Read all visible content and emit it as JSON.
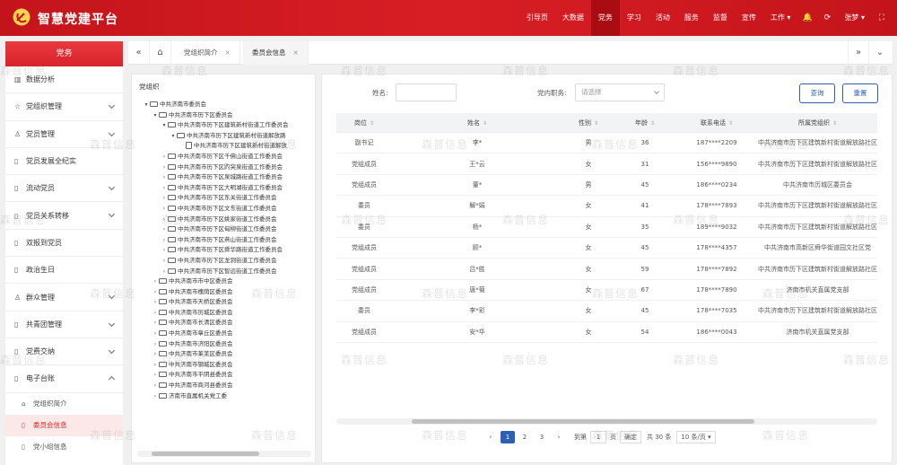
{
  "app": {
    "brand": "智慧党建平台"
  },
  "colors": {
    "primary_red": "#d9232a",
    "accent_blue": "#2f5fb3"
  },
  "nav": {
    "items": [
      {
        "label": "引导页",
        "active": false
      },
      {
        "label": "大数据",
        "active": false
      },
      {
        "label": "党务",
        "active": true
      },
      {
        "label": "学习",
        "active": false
      },
      {
        "label": "活动",
        "active": false
      },
      {
        "label": "服务",
        "active": false
      },
      {
        "label": "监督",
        "active": false
      },
      {
        "label": "宣传",
        "active": false
      },
      {
        "label": "工作",
        "active": false
      }
    ],
    "user": "张梦"
  },
  "sidebar": {
    "title": "党务",
    "items": [
      {
        "label": "数据分析",
        "icon": "chart-icon"
      },
      {
        "label": "党组织管理",
        "icon": "star-icon"
      },
      {
        "label": "党员管理",
        "icon": "user-icon"
      },
      {
        "label": "党员发展全纪实",
        "icon": "doc-icon"
      },
      {
        "label": "流动党员",
        "icon": "doc-icon"
      },
      {
        "label": "党员关系转移",
        "icon": "doc-icon"
      },
      {
        "label": "双报到党员",
        "icon": "doc-icon"
      },
      {
        "label": "政治生日",
        "icon": "doc-icon"
      },
      {
        "label": "群众管理",
        "icon": "user-icon"
      },
      {
        "label": "共青团管理",
        "icon": "doc-icon"
      },
      {
        "label": "党费交纳",
        "icon": "doc-icon"
      },
      {
        "label": "电子台账",
        "icon": "doc-icon"
      }
    ],
    "subitems": [
      {
        "label": "党组织简介",
        "active": false
      },
      {
        "label": "委员会信息",
        "active": true
      },
      {
        "label": "党小组信息",
        "active": false
      }
    ]
  },
  "tabs": [
    {
      "label": "党组织简介",
      "active": false
    },
    {
      "label": "委员会信息",
      "active": true
    }
  ],
  "tree": {
    "title": "党组织",
    "nodes": [
      {
        "label": "中共济南市委员会",
        "level": 0,
        "expanded": true,
        "leaf": false
      },
      {
        "label": "中共济南市历下区委员会",
        "level": 1,
        "expanded": true,
        "leaf": false
      },
      {
        "label": "中共济南市历下区建筑新村街道工作委员会",
        "level": 2,
        "expanded": true,
        "leaf": false
      },
      {
        "label": "中共济南市历下区建筑新村街道解放路",
        "level": 3,
        "expanded": true,
        "leaf": false
      },
      {
        "label": "中共济南市历下区建筑新村街道解放",
        "level": 4,
        "expanded": false,
        "leaf": true
      },
      {
        "label": "中共济南市历下区千佛山街道工作委员会",
        "level": 2,
        "expanded": false,
        "leaf": false
      },
      {
        "label": "中共济南市历下区趵突泉街道工作委员会",
        "level": 2,
        "expanded": false,
        "leaf": false
      },
      {
        "label": "中共济南市历下区泉城路街道工作委员会",
        "level": 2,
        "expanded": false,
        "leaf": false
      },
      {
        "label": "中共济南市历下区大明湖街道工作委员会",
        "level": 2,
        "expanded": false,
        "leaf": false
      },
      {
        "label": "中共济南市历下区东关街道工作委员会",
        "level": 2,
        "expanded": false,
        "leaf": false
      },
      {
        "label": "中共济南市历下区文东街道工作委员会",
        "level": 2,
        "expanded": false,
        "leaf": false
      },
      {
        "label": "中共济南市历下区姚家街道工作委员会",
        "level": 2,
        "expanded": false,
        "leaf": false
      },
      {
        "label": "中共济南市历下区甸柳街道工作委员会",
        "level": 2,
        "expanded": false,
        "leaf": false
      },
      {
        "label": "中共济南市历下区燕山街道工作委员会",
        "level": 2,
        "expanded": false,
        "leaf": false
      },
      {
        "label": "中共济南市历下区舜华路街道工作委员会",
        "level": 2,
        "expanded": false,
        "leaf": false
      },
      {
        "label": "中共济南市历下区龙洞街道工作委员会",
        "level": 2,
        "expanded": false,
        "leaf": false
      },
      {
        "label": "中共济南市历下区智远街道工作委员会",
        "level": 2,
        "expanded": false,
        "leaf": false
      },
      {
        "label": "中共济南市市中区委员会",
        "level": 1,
        "expanded": false,
        "leaf": false
      },
      {
        "label": "中共济南市槐荫区委员会",
        "level": 1,
        "expanded": false,
        "leaf": false
      },
      {
        "label": "中共济南市天桥区委员会",
        "level": 1,
        "expanded": false,
        "leaf": false
      },
      {
        "label": "中共济南市历城区委员会",
        "level": 1,
        "expanded": false,
        "leaf": false
      },
      {
        "label": "中共济南市长清区委员会",
        "level": 1,
        "expanded": false,
        "leaf": false
      },
      {
        "label": "中共济南市章丘区委员会",
        "level": 1,
        "expanded": false,
        "leaf": false
      },
      {
        "label": "中共济南市济阳区委员会",
        "level": 1,
        "expanded": false,
        "leaf": false
      },
      {
        "label": "中共济南市莱芜区委员会",
        "level": 1,
        "expanded": false,
        "leaf": false
      },
      {
        "label": "中共济南市钢城区委员会",
        "level": 1,
        "expanded": false,
        "leaf": false
      },
      {
        "label": "中共济南市平阴县委员会",
        "level": 1,
        "expanded": false,
        "leaf": false
      },
      {
        "label": "中共济南市商河县委员会",
        "level": 1,
        "expanded": false,
        "leaf": false
      },
      {
        "label": "济南市直属机关党工委",
        "level": 1,
        "expanded": false,
        "leaf": false
      }
    ]
  },
  "filters": {
    "name_label": "姓名:",
    "name_value": "",
    "position_label": "党内职务:",
    "position_placeholder": "请选择",
    "query_label": "查询",
    "reset_label": "重置"
  },
  "table": {
    "columns": [
      "岗位",
      "姓名",
      "性别",
      "年龄",
      "联系电话",
      "所属党组织"
    ],
    "rows": [
      [
        "副书记",
        "李*",
        "男",
        "36",
        "187****2209",
        "中共济南市历下区建筑新村街道解放路社区"
      ],
      [
        "党组成员",
        "王*云",
        "女",
        "31",
        "156****9890",
        "中共济南市历下区建筑新村街道解放路社区"
      ],
      [
        "党组成员",
        "董*",
        "男",
        "45",
        "186****0234",
        "中共济南市历城区委员会"
      ],
      [
        "委员",
        "解*娟",
        "女",
        "41",
        "178****7893",
        "中共济南市历下区建筑新村街道解放路社区"
      ],
      [
        "委员",
        "杨*",
        "女",
        "35",
        "189****9032",
        "中共济南市历下区建筑新村街道解放路社区"
      ],
      [
        "党组成员",
        "顾*",
        "女",
        "45",
        "178****4357",
        "中共济南市高新区舜华街道园文社区党"
      ],
      [
        "党组成员",
        "吕*胜",
        "女",
        "59",
        "178****7892",
        "中共济南市历下区建筑新村街道解放路社区"
      ],
      [
        "党组成员",
        "唐*菊",
        "女",
        "67",
        "178****7890",
        "济南市机关直属党支部"
      ],
      [
        "委员",
        "李*彩",
        "女",
        "45",
        "178****7035",
        "中共济南市历下区建筑新村街道解放路社区"
      ],
      [
        "党组成员",
        "安*华",
        "女",
        "54",
        "186****0043",
        "济南市机关直属党支部"
      ]
    ]
  },
  "pager": {
    "pages": [
      "1",
      "2",
      "3"
    ],
    "current": "1",
    "goto_label": "到第",
    "goto_value": "1",
    "page_unit": "页",
    "confirm_label": "确定",
    "total": "共 30 条",
    "page_size": "10 条/页"
  },
  "watermark": "森普信息"
}
